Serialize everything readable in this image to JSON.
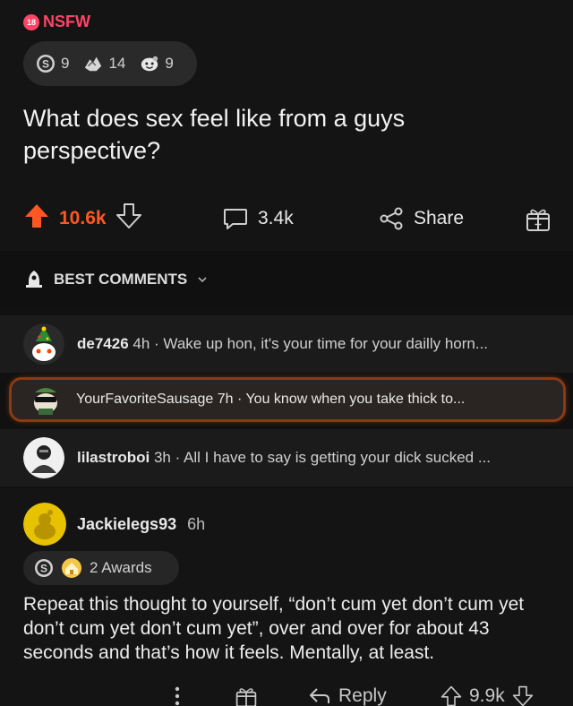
{
  "post": {
    "nsfw_badge": "18",
    "nsfw_label": "NSFW",
    "awards": [
      {
        "icon": "silver-award-icon",
        "count": "9"
      },
      {
        "icon": "helpful-hands-award-icon",
        "count": "14"
      },
      {
        "icon": "wholesome-award-icon",
        "count": "9"
      }
    ],
    "title": "What does sex feel like from a guys perspective?",
    "upvotes": "10.6k",
    "comments": "3.4k",
    "share_label": "Share"
  },
  "sort": {
    "label": "BEST COMMENTS"
  },
  "collapsed_comments": [
    {
      "user": "de7426",
      "meta": " 4h · Wake up hon, it's your time for your dailly horn..."
    },
    {
      "user": "YourFavoriteSausage",
      "meta": " 7h · You know when you take thick to..."
    },
    {
      "user": "lilastroboi",
      "meta": " 3h · All I have to say is getting your dick sucked ..."
    }
  ],
  "expanded_comment": {
    "user": "Jackielegs93",
    "age": "6h",
    "awards_label": "2 Awards",
    "body": "Repeat this thought to yourself, “don’t cum yet don’t cum yet don’t cum yet don’t cum yet”, over and over for about 43 seconds and that’s how it feels. Mentally, at least.",
    "reply_label": "Reply",
    "score": "9.9k"
  },
  "colors": {
    "accent": "#ff5722",
    "nsfw": "#ff4466",
    "highlight_border": "#8a3a14"
  }
}
